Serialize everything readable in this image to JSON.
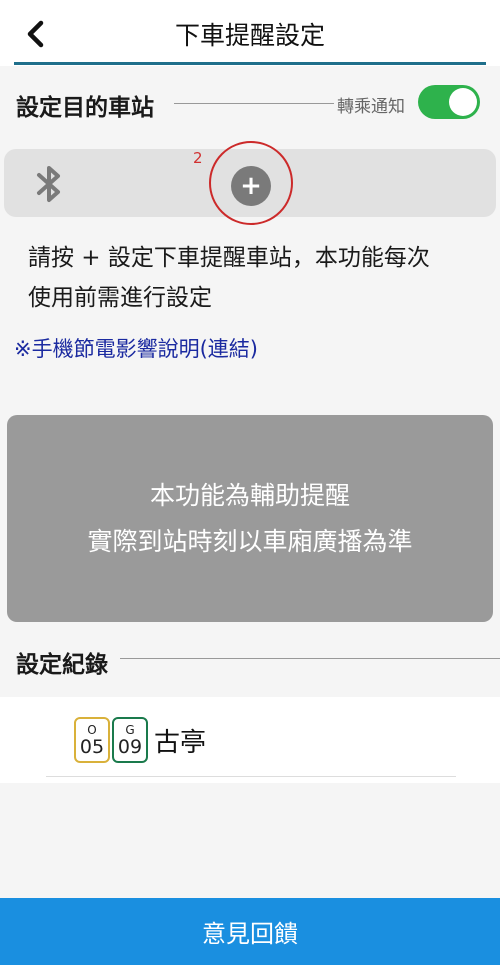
{
  "header": {
    "title": "下車提醒設定",
    "back_icon": "chevron-left-icon"
  },
  "destination": {
    "label": "設定目的車站",
    "transfer_label": "轉乘通知",
    "transfer_enabled": true,
    "toggle_color": "#2eb24c",
    "add_marker_number": "2",
    "add_symbol": "+",
    "bluetooth_icon": "bluetooth-icon"
  },
  "instruction": {
    "line1": "請按 + 設定下車提醒車站，本功能每次",
    "line2": "使用前需進行設定"
  },
  "power_saving_link": "※手機節電影響說明(連結)",
  "notice": {
    "line1": "本功能為輔助提醒",
    "line2": "實際到站時刻以車廂廣播為準"
  },
  "history": {
    "title": "設定紀錄",
    "records": [
      {
        "badges": [
          {
            "line": "O",
            "number": "05",
            "color": "#d9b13a"
          },
          {
            "line": "G",
            "number": "09",
            "color": "#1a7a4c"
          }
        ],
        "station": "古亭"
      }
    ]
  },
  "feedback_button": "意見回饋",
  "colors": {
    "accent_blue": "#1a8fe0",
    "header_underline": "#1f6f8b",
    "link": "#1b2aa0"
  }
}
